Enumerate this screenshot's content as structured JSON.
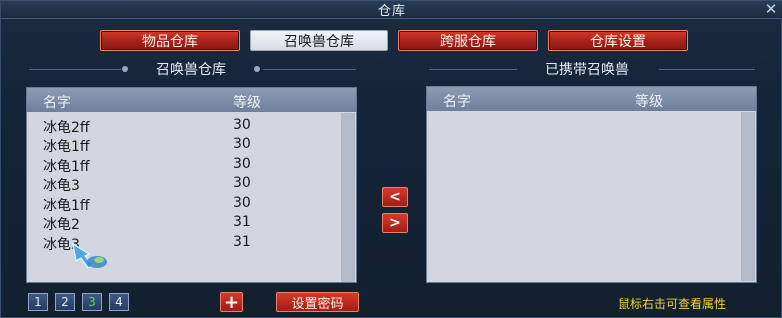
{
  "window": {
    "title": "仓库",
    "close_glyph": "✕"
  },
  "tabs": [
    {
      "label": "物品仓库",
      "active": false
    },
    {
      "label": "召唤兽仓库",
      "active": true
    },
    {
      "label": "跨服仓库",
      "active": false
    },
    {
      "label": "仓库设置",
      "active": false
    }
  ],
  "left_panel": {
    "section_title": "召唤兽仓库",
    "headers": {
      "name": "名字",
      "level": "等级"
    },
    "rows": [
      {
        "name": "冰龟2ff",
        "level": "30"
      },
      {
        "name": "冰龟1ff",
        "level": "30"
      },
      {
        "name": "冰龟1ff",
        "level": "30"
      },
      {
        "name": "冰龟3",
        "level": "30"
      },
      {
        "name": "冰龟1ff",
        "level": "30"
      },
      {
        "name": "冰龟2",
        "level": "31"
      },
      {
        "name": "冰龟3",
        "level": "31"
      }
    ]
  },
  "right_panel": {
    "section_title": "已携带召唤兽",
    "headers": {
      "name": "名字",
      "level": "等级"
    },
    "rows": []
  },
  "transfer": {
    "left_glyph": "<",
    "right_glyph": ">"
  },
  "pagination": {
    "pages": [
      "1",
      "2",
      "3",
      "4"
    ],
    "current": "3"
  },
  "footer": {
    "add_glyph": "+",
    "set_password_label": "设置密码",
    "hint": "鼠标右击可查看属性"
  },
  "colors": {
    "tab_red": "#a5211a",
    "hint_yellow": "#f1d23a",
    "active_page": "#5fd35a"
  }
}
